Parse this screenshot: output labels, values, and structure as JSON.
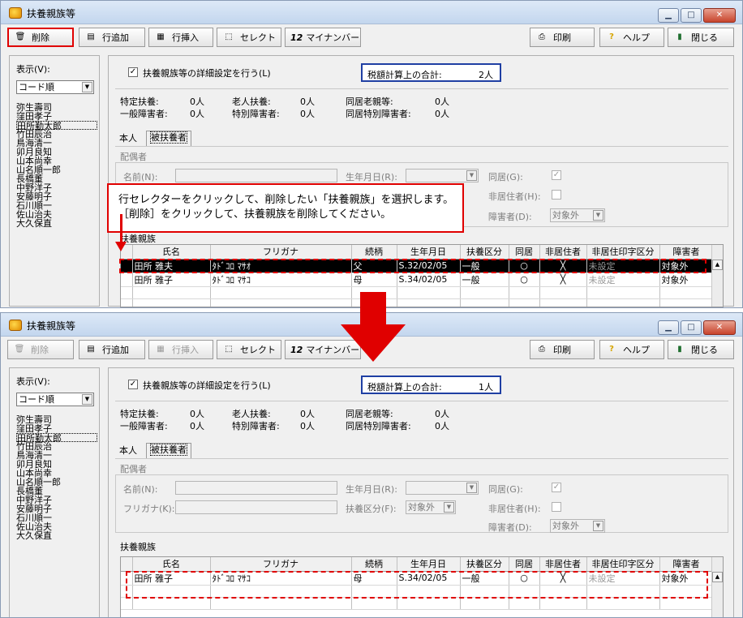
{
  "window": {
    "title": "扶養親族等",
    "min_glyph": "▁",
    "max_glyph": "□",
    "close_glyph": "✕"
  },
  "toolbar": {
    "delete": "削除",
    "add_row": "行追加",
    "insert_row": "行挿入",
    "select": "セレクト",
    "mynumber_prefix": "12",
    "mynumber": "マイナンバー",
    "print": "印刷",
    "help": "ヘルプ",
    "close": "閉じる"
  },
  "left": {
    "display_label": "表示(V):",
    "sort_value": "コード順",
    "employees": [
      "弥生壽司",
      "窪田孝子",
      "田所勤太郎",
      "竹田辰治",
      "鳥海清一",
      "卯月良知",
      "山本尚幸",
      "山名順一郎",
      "長橋董",
      "中野洋子",
      "安藤明子",
      "石川順一",
      "佐山治夫",
      "大久保直"
    ]
  },
  "main": {
    "detail_check_label": "扶養親族等の詳細設定を行う(L)",
    "tax_total_label": "税額計算上の合計:",
    "stats": {
      "tokutei_label": "特定扶養:",
      "tokutei_value": "0人",
      "rojin_label": "老人扶養:",
      "rojin_value": "0人",
      "dokyo_rojin_label": "同居老親等:",
      "dokyo_rojin_value": "0人",
      "ippan_label": "一般障害者:",
      "ippan_value": "0人",
      "tokubetsu_label": "特別障害者:",
      "tokubetsu_value": "0人",
      "dokyo_tokubetsu_label": "同居特別障害者:",
      "dokyo_tokubetsu_value": "0人"
    },
    "tabs": [
      "本人",
      "被扶養者"
    ],
    "spouse": {
      "group_label": "配偶者",
      "name_label": "名前(N):",
      "furigana_label": "フリガナ(K):",
      "birth_label": "生年月日(R):",
      "fuyo_kubun_label": "扶養区分(F):",
      "fuyo_kubun_value": "対象外",
      "dokyo_label": "同居(G):",
      "hikyojusha_label": "非居住者(H):",
      "shogaisha_label": "障害者(D):",
      "shogaisha_value": "対象外",
      "check_glyph": "✓"
    },
    "dependents_label": "扶養親族",
    "columns": [
      "氏名",
      "フリガナ",
      "続柄",
      "生年月日",
      "扶養区分",
      "同居",
      "非居住者",
      "非居住印字区分",
      "障害者"
    ]
  },
  "before": {
    "tax_total_value": "2人",
    "rows": [
      [
        "田所 雅夫",
        "ﾀﾄﾞｺﾛ ﾏｻｵ",
        "父",
        "S.32/02/05",
        "一般",
        "○",
        "╳",
        "未設定",
        "対象外"
      ],
      [
        "田所 雅子",
        "ﾀﾄﾞｺﾛ ﾏｻｺ",
        "母",
        "S.34/02/05",
        "一般",
        "○",
        "╳",
        "未設定",
        "対象外"
      ]
    ]
  },
  "after": {
    "tax_total_value": "1人",
    "rows": [
      [
        "田所 雅子",
        "ﾀﾄﾞｺﾛ ﾏｻｺ",
        "母",
        "S.34/02/05",
        "一般",
        "○",
        "╳",
        "未設定",
        "対象外"
      ]
    ]
  },
  "callout": {
    "line1": "行セレクターをクリックして、削除したい「扶養親族」を選択します。",
    "line2": "［削除］をクリックして、扶養親族を削除してください。"
  },
  "colors": {
    "highlight_red": "#e00000",
    "total_box_blue": "#1f3fa3"
  },
  "icons": {
    "delete": "trash-icon",
    "add_row": "add-row-icon",
    "insert_row": "insert-row-icon",
    "select": "select-icon",
    "print": "printer-icon",
    "help": "question-icon",
    "close": "door-icon"
  }
}
